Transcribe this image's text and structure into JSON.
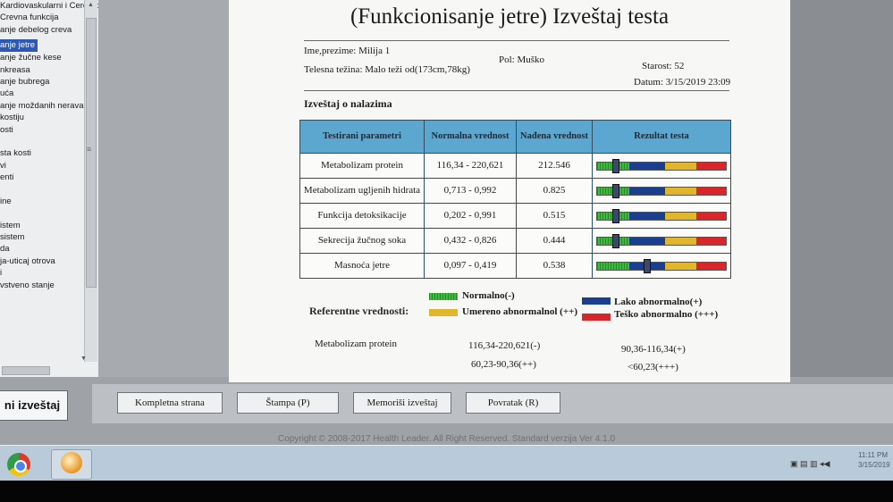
{
  "nav": {
    "items": [
      "Kardiovaskularni i Cerebrovaskul",
      "Crevna funkcija",
      "anje debelog creva",
      "anje jetre",
      "anje žučne kese",
      "nkreasa",
      "anje bubrega",
      "uća",
      "anje moždanih nerava",
      "kostiju",
      "osti",
      "",
      "sta kosti",
      "vi",
      "enti",
      "",
      "ine",
      "",
      "istem",
      "sistem",
      "da",
      "ja-uticaj otrova",
      "i",
      "vstveno stanje"
    ],
    "selected_index": 3,
    "report_button": "ni izveštaj"
  },
  "report": {
    "title": "(Funkcionisanje jetre) Izveštaj testa",
    "name": "Ime,prezime: Milija 1",
    "gender": "Pol: Muško",
    "age": "Starost: 52",
    "weight": "Telesna težina: Malo teži od(173cm,78kg)",
    "date": "Datum: 3/15/2019 23:09",
    "findings_title": "Izveštaj o nalazima",
    "headers": [
      "Testirani parametri",
      "Normalna vrednost",
      "Nađena vrednost",
      "Rezultat testa"
    ],
    "rows": [
      {
        "param": "Metabolizam protein",
        "normal": "116,34 - 220,621",
        "found": "212.546",
        "level": 0.14
      },
      {
        "param": "Metabolizam ugljenih hidrata",
        "normal": "0,713 - 0,992",
        "found": "0.825",
        "level": 0.14
      },
      {
        "param": "Funkcija detoksikacije",
        "normal": "0,202 - 0,991",
        "found": "0.515",
        "level": 0.14
      },
      {
        "param": "Sekrecija žučnog soka",
        "normal": "0,432 - 0,826",
        "found": "0.444",
        "level": 0.14
      },
      {
        "param": "Masnoća jetre",
        "normal": "0,097 - 0,419",
        "found": "0.538",
        "level": 0.38
      }
    ],
    "legend_title": "Referentne vrednosti:",
    "legend": {
      "normal": "Normalno(-)",
      "moderate": "Umereno abnormalnol (++)",
      "light": "Lako abnormalno(+)",
      "severe": "Teško abnormalno (+++)"
    },
    "ref_param": "Metabolizam protein",
    "ref_values": [
      "116,34-220,621(-)",
      "90,36-116,34(+)",
      "60,23-90,36(++)",
      "<60,23(+++)"
    ]
  },
  "buttons": {
    "full_page": "Kompletna strana",
    "print": "Štampa (P)",
    "save": "Memoriši izveštaj",
    "back": "Povratak (R)"
  },
  "copyright": "Copyright © 2008-2017 Health Leader. All Right Reserved.  Standard verzija Ver 4.1.0",
  "clock": {
    "time": "11:11 PM",
    "date": "3/15/2019"
  },
  "colors": {
    "normal": "#3fb83f",
    "light": "#1b3f8f",
    "moderate": "#e2b62c",
    "severe": "#d8262a",
    "header": "#5ca7cf",
    "rule": "#d53a3a"
  }
}
